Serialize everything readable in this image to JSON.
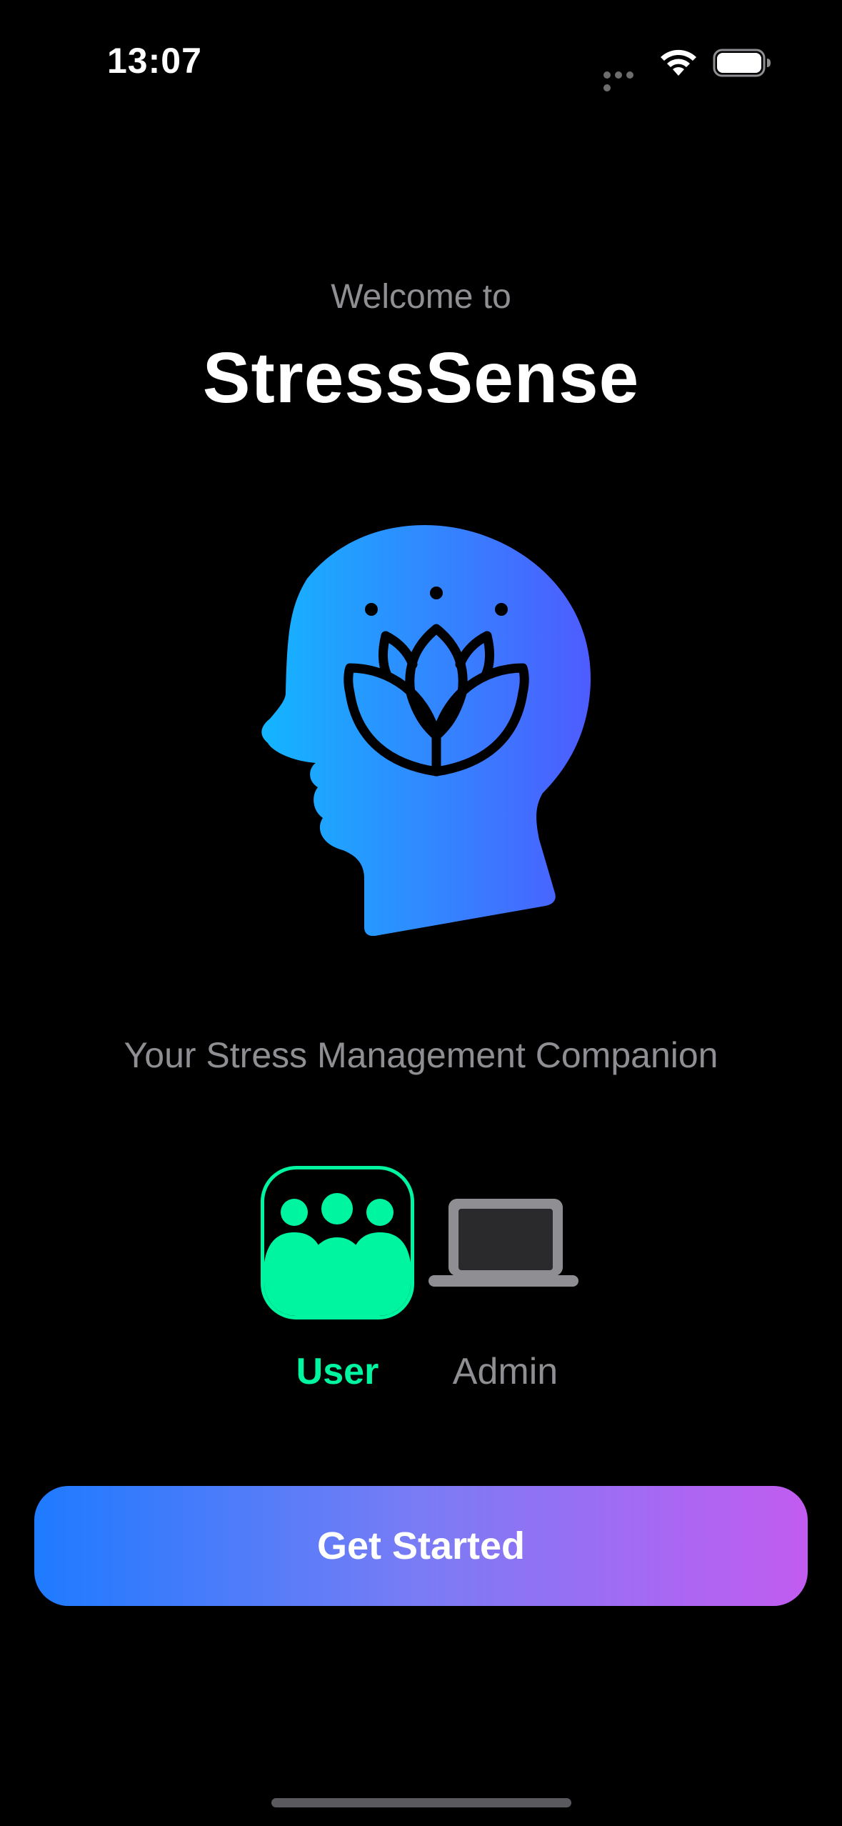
{
  "status_bar": {
    "time": "13:07",
    "icons": [
      "cellular-dots-icon",
      "wifi-icon",
      "battery-icon"
    ]
  },
  "header": {
    "welcome": "Welcome to",
    "app_name": "StressSense"
  },
  "illustration": {
    "icon": "head-lotus-icon",
    "gradient": [
      "#13b5ff",
      "#4e5cff"
    ]
  },
  "tagline": "Your Stress Management Companion",
  "roles": {
    "selected": "User",
    "options": [
      {
        "label": "User",
        "icon": "people-group-icon",
        "color": "#00f5a0"
      },
      {
        "label": "Admin",
        "icon": "laptop-icon",
        "color": "#8e8e93"
      }
    ]
  },
  "cta": {
    "label": "Get Started",
    "gradient": [
      "#1e7bff",
      "#c25cf0"
    ]
  },
  "colors": {
    "background": "#000000",
    "secondary_text": "#8e8e93",
    "accent": "#00f5a0"
  }
}
